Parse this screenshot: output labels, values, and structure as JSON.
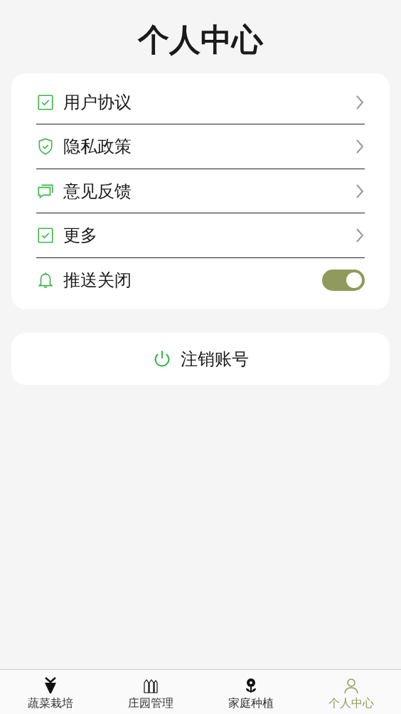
{
  "title": "个人中心",
  "menu": [
    {
      "label": "用户协议",
      "kind": "link"
    },
    {
      "label": "隐私政策",
      "kind": "link"
    },
    {
      "label": "意见反馈",
      "kind": "link"
    },
    {
      "label": "更多",
      "kind": "link"
    },
    {
      "label": "推送关闭",
      "kind": "toggle",
      "on": true
    }
  ],
  "logout": {
    "label": "注销账号"
  },
  "tabs": [
    {
      "label": "蔬菜栽培",
      "selected": false
    },
    {
      "label": "庄园管理",
      "selected": false
    },
    {
      "label": "家庭种植",
      "selected": false
    },
    {
      "label": "个人中心",
      "selected": true
    }
  ]
}
